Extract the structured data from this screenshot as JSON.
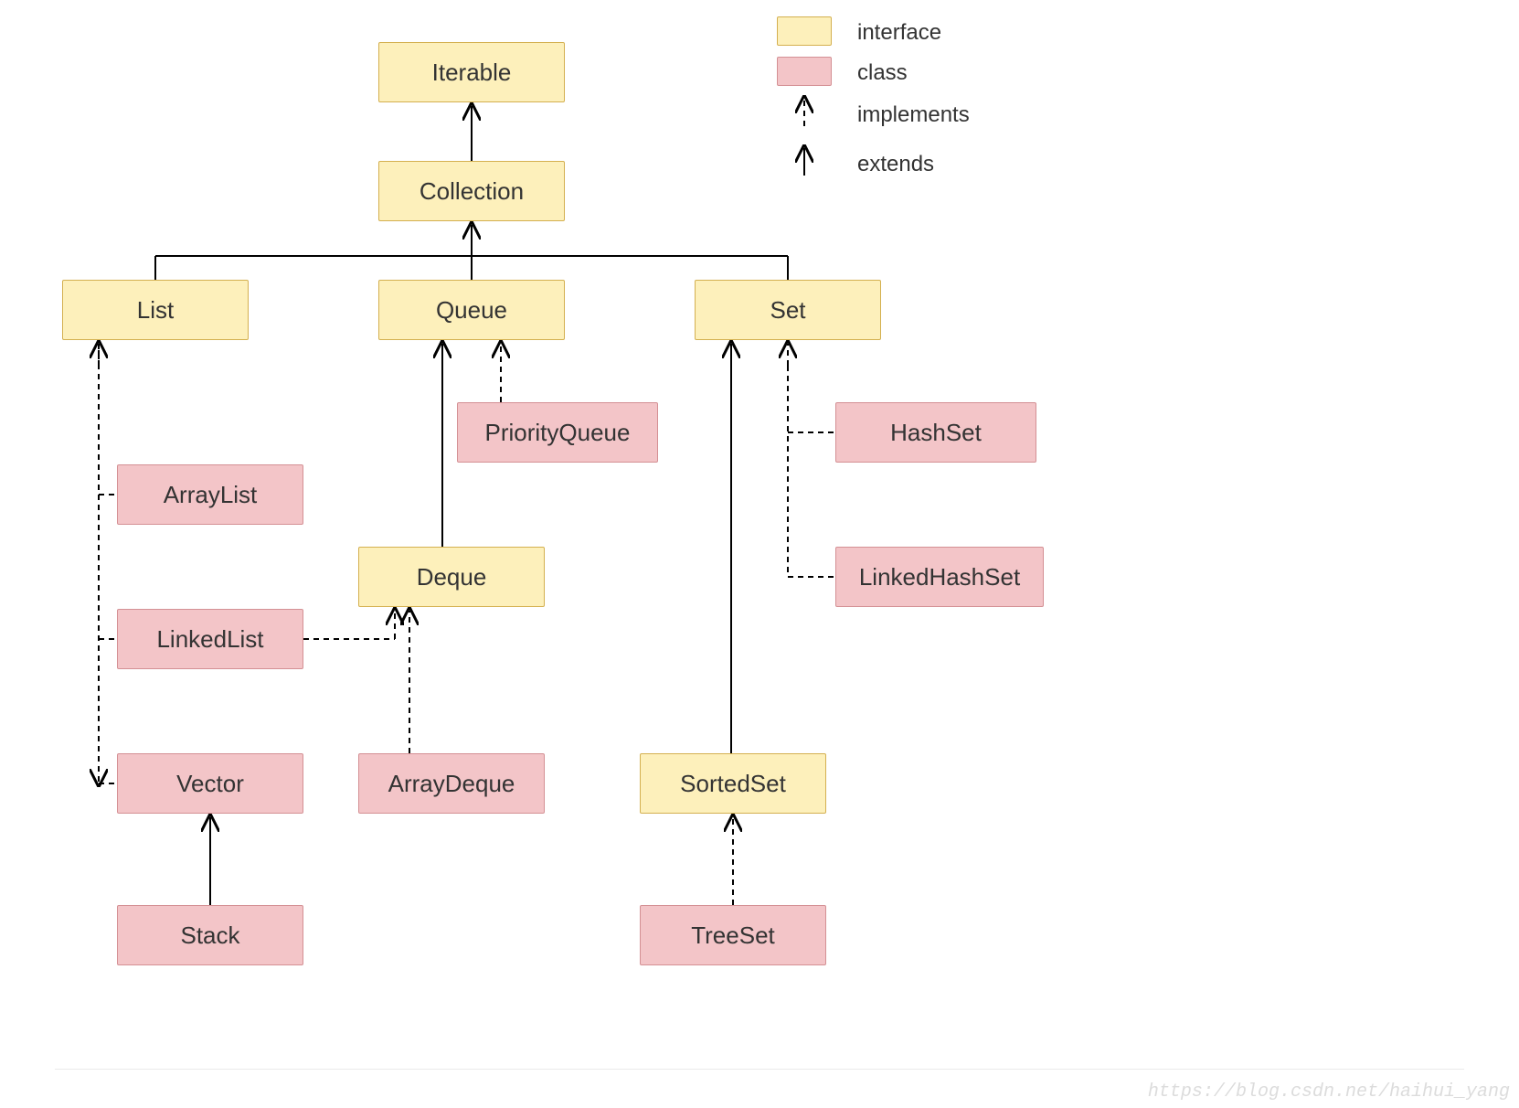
{
  "nodes": {
    "iterable": {
      "label": "Iterable",
      "type": "interface"
    },
    "collection": {
      "label": "Collection",
      "type": "interface"
    },
    "list": {
      "label": "List",
      "type": "interface"
    },
    "queue": {
      "label": "Queue",
      "type": "interface"
    },
    "set": {
      "label": "Set",
      "type": "interface"
    },
    "deque": {
      "label": "Deque",
      "type": "interface"
    },
    "sortedset": {
      "label": "SortedSet",
      "type": "interface"
    },
    "arraylist": {
      "label": "ArrayList",
      "type": "class"
    },
    "linkedlist": {
      "label": "LinkedList",
      "type": "class"
    },
    "vector": {
      "label": "Vector",
      "type": "class"
    },
    "stack": {
      "label": "Stack",
      "type": "class"
    },
    "priorityqueue": {
      "label": "PriorityQueue",
      "type": "class"
    },
    "arraydeque": {
      "label": "ArrayDeque",
      "type": "class"
    },
    "hashset": {
      "label": "HashSet",
      "type": "class"
    },
    "linkedhashset": {
      "label": "LinkedHashSet",
      "type": "class"
    },
    "treeset": {
      "label": "TreeSet",
      "type": "class"
    }
  },
  "legend": {
    "interface": "interface",
    "class": "class",
    "implements": "implements",
    "extends": "extends"
  },
  "edges": [
    {
      "from": "collection",
      "to": "iterable",
      "rel": "extends"
    },
    {
      "from": "list",
      "to": "collection",
      "rel": "extends"
    },
    {
      "from": "queue",
      "to": "collection",
      "rel": "extends"
    },
    {
      "from": "set",
      "to": "collection",
      "rel": "extends"
    },
    {
      "from": "arraylist",
      "to": "list",
      "rel": "implements"
    },
    {
      "from": "linkedlist",
      "to": "list",
      "rel": "implements"
    },
    {
      "from": "linkedlist",
      "to": "deque",
      "rel": "implements"
    },
    {
      "from": "vector",
      "to": "list",
      "rel": "implements"
    },
    {
      "from": "stack",
      "to": "vector",
      "rel": "extends"
    },
    {
      "from": "deque",
      "to": "queue",
      "rel": "extends"
    },
    {
      "from": "priorityqueue",
      "to": "queue",
      "rel": "implements"
    },
    {
      "from": "arraydeque",
      "to": "deque",
      "rel": "implements"
    },
    {
      "from": "sortedset",
      "to": "set",
      "rel": "extends"
    },
    {
      "from": "hashset",
      "to": "set",
      "rel": "implements"
    },
    {
      "from": "linkedhashset",
      "to": "set",
      "rel": "implements"
    },
    {
      "from": "treeset",
      "to": "sortedset",
      "rel": "implements"
    }
  ],
  "colors": {
    "interface_fill": "#fdf0bb",
    "interface_border": "#d4b050",
    "class_fill": "#f3c5c8",
    "class_border": "#d49094",
    "line": "#000000"
  },
  "watermark": "https://blog.csdn.net/haihui_yang"
}
